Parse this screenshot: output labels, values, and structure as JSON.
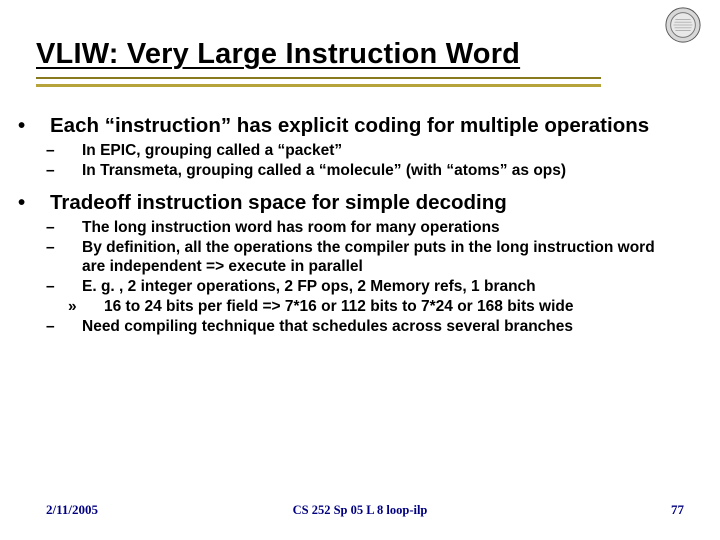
{
  "title": "VLIW: Very Large Instruction Word",
  "bullets": {
    "b1": "Each “instruction” has explicit coding for multiple operations",
    "b1subs": {
      "s1": "In EPIC, grouping called a “packet”",
      "s2": "In Transmeta, grouping called a “molecule” (with “atoms” as ops)"
    },
    "b2": "Tradeoff instruction space for simple decoding",
    "b2subs": {
      "s1": "The long instruction word has room for many operations",
      "s2": "By definition, all the operations the compiler puts in the long instruction word are independent => execute in parallel",
      "s3": "E. g. , 2 integer operations, 2 FP ops, 2 Memory refs, 1 branch",
      "s3subs": {
        "t1": "16 to 24 bits per field => 7*16 or 112 bits to 7*24 or 168 bits wide"
      },
      "s4": "Need compiling technique that schedules across several branches"
    }
  },
  "footer": {
    "date": "2/11/2005",
    "center": "CS 252 Sp 05 L 8 loop-ilp",
    "page": "77"
  },
  "logo_name": "seal-logo"
}
